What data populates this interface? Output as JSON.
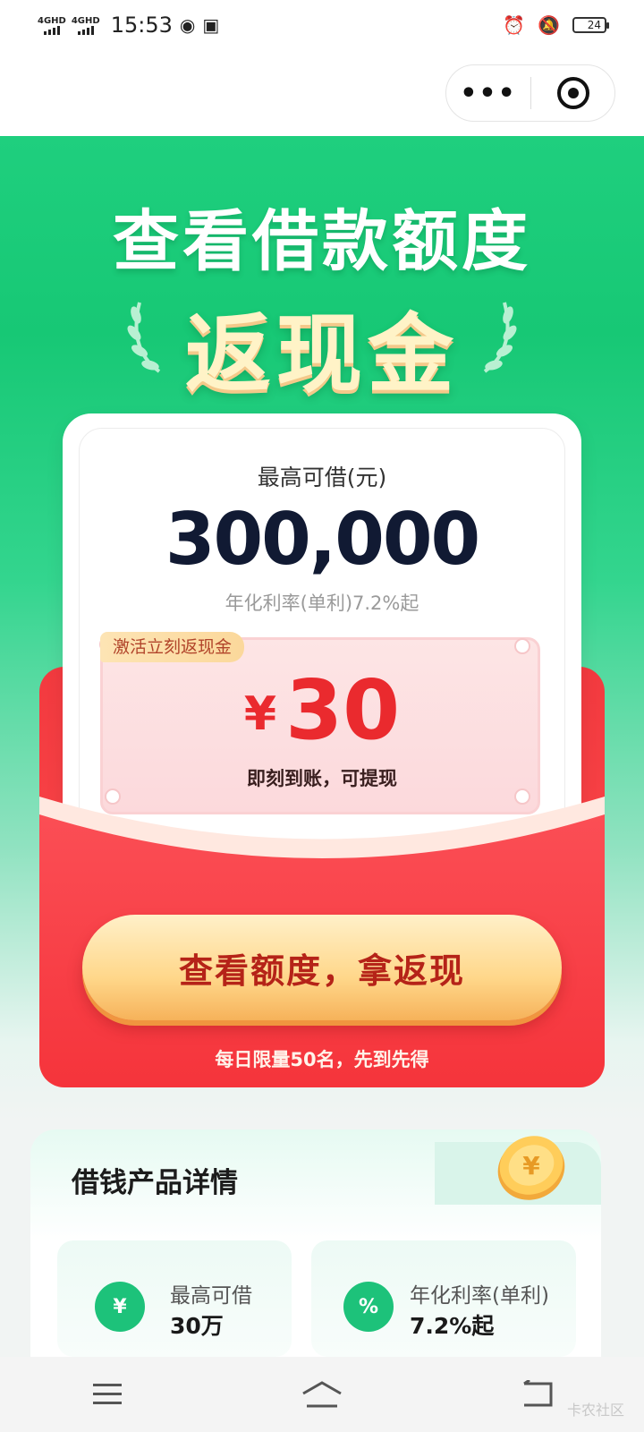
{
  "status_bar": {
    "signal1": "4GHD",
    "signal2": "4GHD",
    "time": "15:53",
    "battery": "24"
  },
  "hero": {
    "title": "查看借款额度",
    "subtitle": "返现金"
  },
  "card": {
    "label": "最高可借(元)",
    "amount": "300,000",
    "rate": "年化利率(单利)7.2%起"
  },
  "coupon": {
    "tag": "激活立刻返现金",
    "currency": "¥",
    "value": "30",
    "note": "即刻到账，可提现"
  },
  "cta": {
    "label": "查看额度，拿返现",
    "limit_note": "每日限量50名，先到先得"
  },
  "details": {
    "title": "借钱产品详情",
    "stats": [
      {
        "label": "最高可借",
        "value": "30万",
        "icon": "money-bag-icon"
      },
      {
        "label": "年化利率(单利)",
        "value": "7.2%起",
        "icon": "percent-calendar-icon"
      }
    ]
  },
  "watermark": "卡农社区",
  "colors": {
    "brand_green": "#17c875",
    "envelope_red": "#f23a3f",
    "cta_gold": "#ffd78a",
    "cta_text": "#b52318"
  }
}
